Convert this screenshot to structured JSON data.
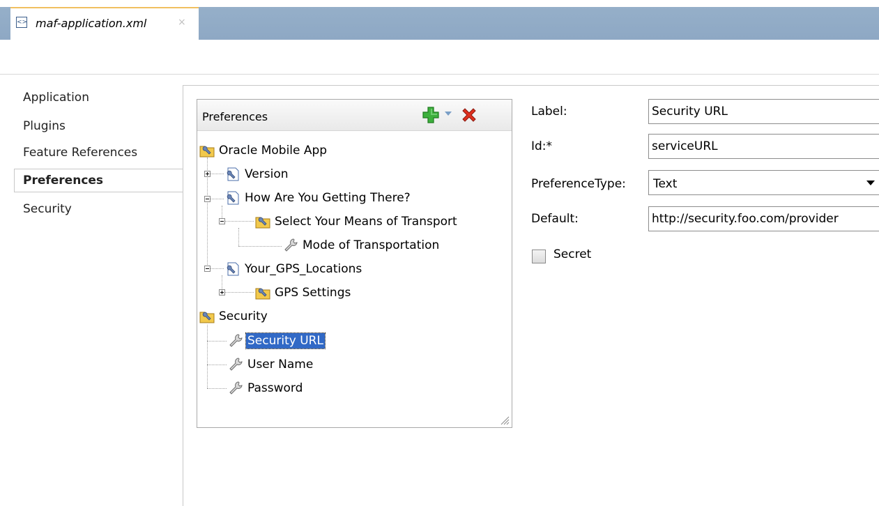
{
  "editor_tab": {
    "title": "maf-application.xml",
    "close": "×"
  },
  "nav": {
    "items": [
      {
        "label": "Application",
        "selected": false
      },
      {
        "label": "Plugins",
        "selected": false
      },
      {
        "label": "Feature References",
        "selected": false
      },
      {
        "label": "Preferences",
        "selected": true
      },
      {
        "label": "Security",
        "selected": false
      }
    ]
  },
  "preferences_panel": {
    "title": "Preferences",
    "tree": [
      {
        "label": "Oracle Mobile App",
        "icon": "pref-group-folder-icon",
        "depth": 0
      },
      {
        "label": "Version",
        "icon": "pref-page-icon",
        "depth": 1,
        "expander": "plus"
      },
      {
        "label": "How Are You Getting There?",
        "icon": "pref-page-icon",
        "depth": 1,
        "expander": "minus"
      },
      {
        "label": "Select Your Means of Transport",
        "icon": "pref-group-folder-icon",
        "depth": 2,
        "expander": "minus"
      },
      {
        "label": "Mode of Transportation",
        "icon": "wrench-icon",
        "depth": 3
      },
      {
        "label": "Your_GPS_Locations",
        "icon": "pref-page-icon",
        "depth": 1,
        "expander": "minus"
      },
      {
        "label": "GPS Settings",
        "icon": "pref-group-folder-icon",
        "depth": 2,
        "expander": "plus"
      },
      {
        "label": "Security",
        "icon": "pref-group-folder-icon",
        "depth": 0
      },
      {
        "label": "Security URL",
        "icon": "wrench-icon",
        "depth": 1,
        "selected": true
      },
      {
        "label": "User Name",
        "icon": "wrench-icon",
        "depth": 1
      },
      {
        "label": "Password",
        "icon": "wrench-icon",
        "depth": 1
      }
    ]
  },
  "form": {
    "label_label": "Label:",
    "label_value": "Security URL",
    "id_label": "Id:*",
    "id_value": "serviceURL",
    "type_label": "PreferenceType:",
    "type_value": "Text",
    "default_label": "Default:",
    "default_value": "http://security.foo.com/provider",
    "secret_label": "Secret",
    "secret_checked": false
  },
  "colors": {
    "tab_bar": "#8ea8c4",
    "selection": "#3169c6",
    "add_green": "#3db03d",
    "delete_red": "#e0301e"
  }
}
